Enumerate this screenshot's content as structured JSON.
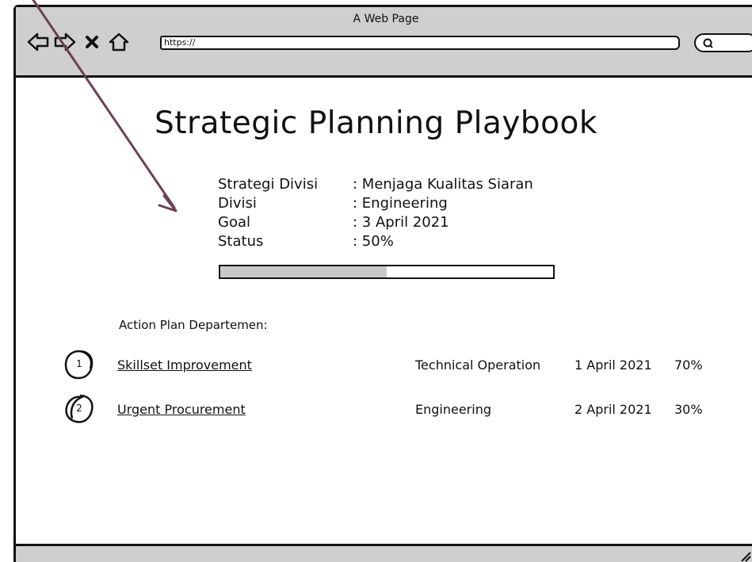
{
  "window": {
    "title": "A Web Page",
    "url": "https://"
  },
  "page": {
    "title": "Strategic Planning Playbook"
  },
  "info": [
    {
      "label": "Strategi Divisi",
      "value": ": Menjaga Kualitas Siaran"
    },
    {
      "label": "Divisi",
      "value": ": Engineering"
    },
    {
      "label": "Goal",
      "value": ": 3 April 2021"
    },
    {
      "label": "Status",
      "value": ": 50%"
    }
  ],
  "progress": {
    "fraction": 0.5
  },
  "action_plan": {
    "label": "Action Plan Departemen:",
    "items": [
      {
        "number": "1",
        "name": "Skillset Improvement",
        "department": "Technical Operation",
        "date": "1 April 2021",
        "percent": "70%"
      },
      {
        "number": "2",
        "name": "Urgent Procurement",
        "department": "Engineering",
        "date": "2 April 2021",
        "percent": "30%"
      }
    ]
  },
  "colors": {
    "chrome": "#cfcfcf",
    "progress_fill": "#c9c9c9",
    "arrow": "#6b4058"
  },
  "icons": [
    "back-icon",
    "forward-icon",
    "close-icon",
    "home-icon",
    "search-icon",
    "resize-grip-icon"
  ]
}
